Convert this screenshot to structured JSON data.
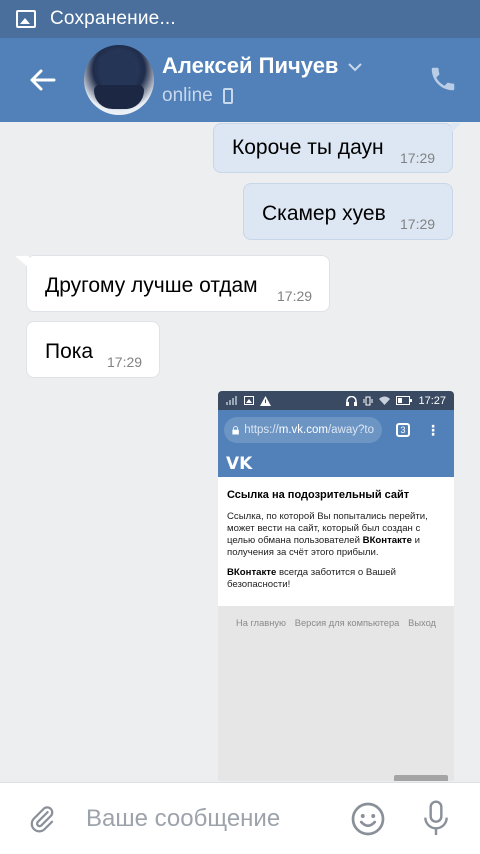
{
  "statusbar": {
    "text": "Сохранение...",
    "icon": "image-icon"
  },
  "header": {
    "name": "Алексей Пичуев",
    "status": "online",
    "icons": [
      "back-arrow-icon",
      "chevron-down-icon",
      "mobile-phone-icon",
      "call-icon"
    ]
  },
  "messages": [
    {
      "direction": "out",
      "text": "Короче ты даун",
      "time": "17:29"
    },
    {
      "direction": "out",
      "text": "Скамер хуев",
      "time": "17:29"
    },
    {
      "direction": "in",
      "text": "Другому лучше отдам",
      "time": "17:29"
    },
    {
      "direction": "in",
      "text": "Пока",
      "time": "17:29"
    }
  ],
  "attachment": {
    "status_time": "17:27",
    "url_prefix": "https://",
    "url_host": "m.vk.com",
    "url_path": "/away?to",
    "tabs_count": "3",
    "logo": "VK",
    "title": "Ссылка на подозрительный сайт",
    "paragraph1_start": "Ссылка, по которой Вы попытались перейти, может вести на сайт, который был создан с целью обмана пользователей ",
    "paragraph1_bold": "ВКонтакте",
    "paragraph1_end": " и получения за счёт этого прибыли.",
    "paragraph2_bold": "ВКонтакте",
    "paragraph2_end": " всегда заботится о Вашей безопасности!",
    "footer": [
      "На главную",
      "Версия для компьютера",
      "Выход"
    ]
  },
  "composer": {
    "placeholder": "Ваше сообщение",
    "icons": [
      "paperclip-icon",
      "emoji-icon",
      "microphone-icon"
    ]
  },
  "colors": {
    "header": "#5181b8",
    "statusbar": "#4a6f9c",
    "outgoing_bubble": "#dde7f3",
    "background": "#edeef0"
  }
}
